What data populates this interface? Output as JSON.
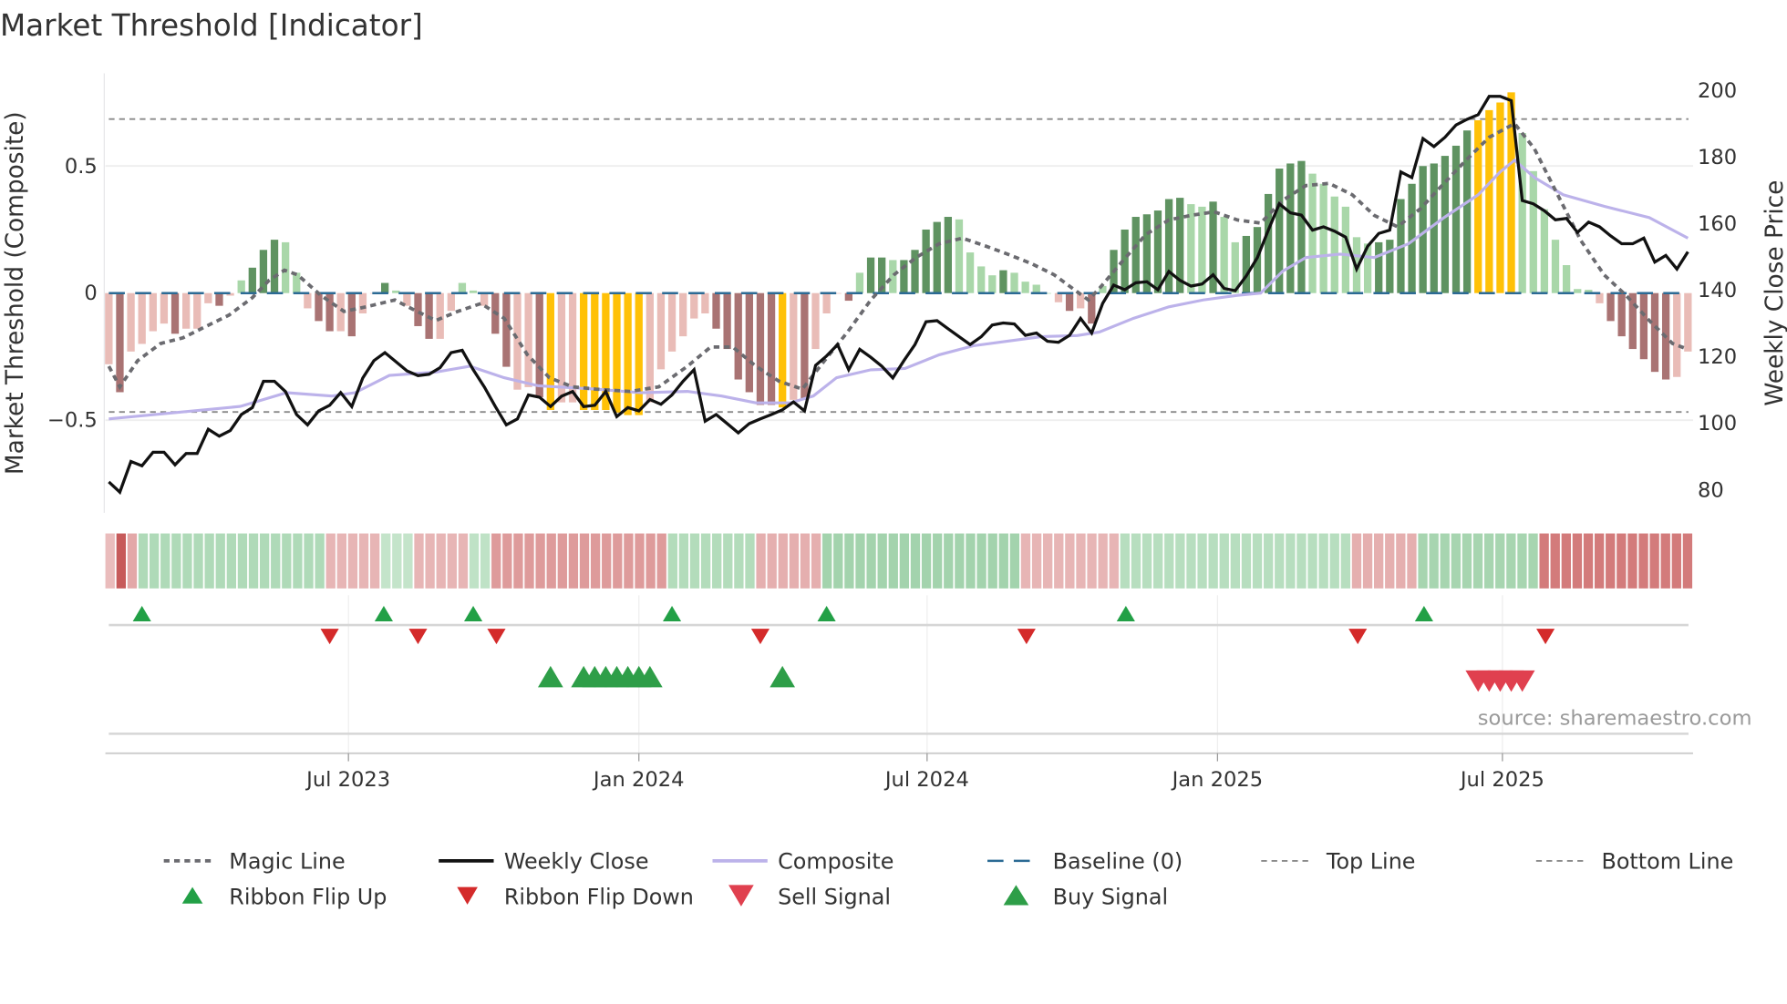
{
  "chart_data": {
    "type": "bar",
    "title": "Market Threshold [Indicator]",
    "x_unit": "weeks since start of series",
    "x_ticks": [
      {
        "week": 21.7,
        "label": "Jul 2023"
      },
      {
        "week": 48.0,
        "label": "Jan 2024"
      },
      {
        "week": 74.1,
        "label": "Jul 2024"
      },
      {
        "week": 100.4,
        "label": "Jan 2025"
      },
      {
        "week": 126.2,
        "label": "Jul 2025"
      }
    ],
    "left_axis": {
      "label": "Market Threshold (Composite)",
      "ticks": [
        {
          "value": 0.5,
          "label": "0.5"
        },
        {
          "value": 0,
          "label": "0"
        },
        {
          "value": -0.5,
          "label": "−0.5"
        }
      ]
    },
    "right_axis": {
      "label": "Weekly Close Price",
      "ticks": [
        {
          "value": 200,
          "label": "200"
        },
        {
          "value": 180,
          "label": "180"
        },
        {
          "value": 160,
          "label": "160"
        },
        {
          "value": 140,
          "label": "140"
        },
        {
          "value": 120,
          "label": "120"
        },
        {
          "value": 100,
          "label": "100"
        },
        {
          "value": 80,
          "label": "80"
        }
      ]
    },
    "top_line": 0.685,
    "bottom_line": -0.468,
    "baseline": 0,
    "palette": {
      "dr": "#a97373",
      "lr": "#e9bcb7",
      "dg": "#5f9361",
      "lg": "#a9d7a9",
      "y": "#ffc107",
      "magic": "#6b6b70",
      "close": "#111111",
      "composite": "#bcb2ea",
      "baseline": "#2b6a94",
      "threshold": "#8a8a8a",
      "flip_up": "#22a046",
      "flip_down": "#d42a2a",
      "buy": "#2e9e48",
      "sell": "#e0404f"
    },
    "bars": {
      "values": [
        -0.28,
        -0.39,
        -0.23,
        -0.2,
        -0.15,
        -0.12,
        -0.16,
        -0.14,
        -0.14,
        -0.04,
        -0.05,
        -0.01,
        0.05,
        0.1,
        0.17,
        0.21,
        0.2,
        0.08,
        -0.06,
        -0.11,
        -0.15,
        -0.15,
        -0.17,
        -0.08,
        0,
        0.04,
        0.01,
        -0.05,
        -0.13,
        -0.18,
        -0.18,
        -0.07,
        0.04,
        0.01,
        -0.05,
        -0.16,
        -0.29,
        -0.38,
        -0.37,
        -0.41,
        -0.46,
        -0.43,
        -0.43,
        -0.46,
        -0.46,
        -0.46,
        -0.47,
        -0.48,
        -0.48,
        -0.43,
        -0.3,
        -0.23,
        -0.17,
        -0.1,
        -0.08,
        -0.14,
        -0.22,
        -0.34,
        -0.39,
        -0.44,
        -0.44,
        -0.45,
        -0.42,
        -0.42,
        -0.22,
        -0.08,
        0,
        -0.03,
        0.08,
        0.14,
        0.14,
        0.13,
        0.13,
        0.17,
        0.25,
        0.28,
        0.3,
        0.29,
        0.16,
        0.105,
        0.07,
        0.09,
        0.08,
        0.045,
        0.033,
        0,
        -0.036,
        -0.07,
        -0.06,
        -0.12,
        0.028,
        0.17,
        0.25,
        0.3,
        0.31,
        0.325,
        0.37,
        0.375,
        0.35,
        0.34,
        0.36,
        0.3,
        0.2,
        0.225,
        0.26,
        0.39,
        0.49,
        0.51,
        0.52,
        0.47,
        0.43,
        0.38,
        0.34,
        0.22,
        0.195,
        0.2,
        0.21,
        0.37,
        0.43,
        0.5,
        0.51,
        0.54,
        0.58,
        0.64,
        0.68,
        0.72,
        0.75,
        0.79,
        0.63,
        0.48,
        0.33,
        0.21,
        0.11,
        0.016,
        0.013,
        -0.04,
        -0.11,
        -0.17,
        -0.22,
        -0.26,
        -0.31,
        -0.34,
        -0.33,
        -0.23
      ],
      "colors": [
        "lr",
        "dr",
        "lr",
        "lr",
        "lr",
        "lr",
        "dr",
        "lr",
        "lr",
        "lr",
        "dr",
        "lr",
        "lg",
        "dg",
        "dg",
        "dg",
        "lg",
        "lg",
        "lr",
        "dr",
        "dr",
        "lr",
        "dr",
        "lr",
        "lr",
        "dg",
        "lg",
        "lr",
        "dr",
        "dr",
        "lr",
        "lr",
        "lg",
        "lg",
        "lr",
        "dr",
        "dr",
        "lr",
        "lr",
        "dr",
        "y",
        "lr",
        "lr",
        "y",
        "y",
        "y",
        "y",
        "y",
        "y",
        "lr",
        "lr",
        "lr",
        "lr",
        "lr",
        "lr",
        "dr",
        "dr",
        "dr",
        "dr",
        "dr",
        "dr",
        "y",
        "lr",
        "dr",
        "lr",
        "lr",
        "lr",
        "dr",
        "lg",
        "dg",
        "dg",
        "lg",
        "dg",
        "dg",
        "dg",
        "dg",
        "dg",
        "lg",
        "lg",
        "lg",
        "lg",
        "dg",
        "lg",
        "lg",
        "lg",
        "lg",
        "lr",
        "dr",
        "lr",
        "dr",
        "lg",
        "dg",
        "dg",
        "dg",
        "dg",
        "dg",
        "dg",
        "dg",
        "lg",
        "lg",
        "dg",
        "lg",
        "lg",
        "dg",
        "dg",
        "dg",
        "dg",
        "dg",
        "dg",
        "lg",
        "lg",
        "lg",
        "lg",
        "lg",
        "lg",
        "dg",
        "dg",
        "dg",
        "dg",
        "dg",
        "dg",
        "dg",
        "dg",
        "dg",
        "y",
        "y",
        "y",
        "y",
        "lg",
        "lg",
        "lg",
        "lg",
        "lg",
        "lg",
        "lg",
        "lr",
        "dr",
        "dr",
        "dr",
        "dr",
        "dr",
        "dr",
        "lr",
        "lr"
      ]
    },
    "magic_line": [
      [
        0,
        -0.288
      ],
      [
        1,
        -0.369
      ],
      [
        2.6,
        -0.266
      ],
      [
        4.7,
        -0.198
      ],
      [
        6.7,
        -0.176
      ],
      [
        8.8,
        -0.131
      ],
      [
        10.9,
        -0.086
      ],
      [
        13,
        -0.018
      ],
      [
        14.5,
        0.05
      ],
      [
        15.9,
        0.09
      ],
      [
        17.1,
        0.072
      ],
      [
        19.2,
        -0.009
      ],
      [
        21.3,
        -0.072
      ],
      [
        23.3,
        -0.054
      ],
      [
        25.9,
        -0.027
      ],
      [
        27.5,
        -0.063
      ],
      [
        29.6,
        -0.108
      ],
      [
        31.6,
        -0.072
      ],
      [
        33.7,
        -0.041
      ],
      [
        35.8,
        -0.099
      ],
      [
        37.9,
        -0.243
      ],
      [
        39.9,
        -0.333
      ],
      [
        42,
        -0.369
      ],
      [
        44.1,
        -0.378
      ],
      [
        47.2,
        -0.387
      ],
      [
        49.8,
        -0.369
      ],
      [
        52.4,
        -0.288
      ],
      [
        54.5,
        -0.212
      ],
      [
        56.5,
        -0.212
      ],
      [
        58.6,
        -0.288
      ],
      [
        60.7,
        -0.347
      ],
      [
        62.8,
        -0.378
      ],
      [
        64.8,
        -0.266
      ],
      [
        66.9,
        -0.153
      ],
      [
        69,
        -0.027
      ],
      [
        71.1,
        0.072
      ],
      [
        73.1,
        0.14
      ],
      [
        75.2,
        0.194
      ],
      [
        77.3,
        0.216
      ],
      [
        79.4,
        0.185
      ],
      [
        81.4,
        0.153
      ],
      [
        83.5,
        0.117
      ],
      [
        85.6,
        0.072
      ],
      [
        87.7,
        0.005
      ],
      [
        88.7,
        -0.027
      ],
      [
        89.7,
        0.018
      ],
      [
        91.8,
        0.126
      ],
      [
        93.9,
        0.23
      ],
      [
        96,
        0.288
      ],
      [
        98,
        0.306
      ],
      [
        100.1,
        0.32
      ],
      [
        102.2,
        0.288
      ],
      [
        104.3,
        0.275
      ],
      [
        106.3,
        0.365
      ],
      [
        108.4,
        0.423
      ],
      [
        110.5,
        0.432
      ],
      [
        112.6,
        0.387
      ],
      [
        114.6,
        0.306
      ],
      [
        116.7,
        0.261
      ],
      [
        118.8,
        0.333
      ],
      [
        120.9,
        0.432
      ],
      [
        122.9,
        0.523
      ],
      [
        125,
        0.613
      ],
      [
        127.3,
        0.667
      ],
      [
        129.1,
        0.568
      ],
      [
        131.2,
        0.387
      ],
      [
        133.3,
        0.207
      ],
      [
        135.4,
        0.072
      ],
      [
        137.4,
        -0.009
      ],
      [
        139.5,
        -0.108
      ],
      [
        141.6,
        -0.198
      ],
      [
        143,
        -0.221
      ]
    ],
    "composite": [
      [
        0,
        -0.495
      ],
      [
        11.9,
        -0.446
      ],
      [
        16.1,
        -0.392
      ],
      [
        20.2,
        -0.405
      ],
      [
        22.3,
        -0.392
      ],
      [
        25.4,
        -0.324
      ],
      [
        29.6,
        -0.311
      ],
      [
        32.7,
        -0.288
      ],
      [
        35.8,
        -0.333
      ],
      [
        38.9,
        -0.365
      ],
      [
        44.1,
        -0.378
      ],
      [
        48.2,
        -0.392
      ],
      [
        52.4,
        -0.387
      ],
      [
        55.5,
        -0.405
      ],
      [
        58.6,
        -0.432
      ],
      [
        61.7,
        -0.432
      ],
      [
        63.8,
        -0.405
      ],
      [
        65.9,
        -0.333
      ],
      [
        69,
        -0.302
      ],
      [
        72.1,
        -0.297
      ],
      [
        75.2,
        -0.243
      ],
      [
        78.3,
        -0.207
      ],
      [
        81.4,
        -0.189
      ],
      [
        84.5,
        -0.171
      ],
      [
        87.7,
        -0.167
      ],
      [
        89.7,
        -0.153
      ],
      [
        92.8,
        -0.099
      ],
      [
        96,
        -0.054
      ],
      [
        99.1,
        -0.027
      ],
      [
        102.2,
        -0.009
      ],
      [
        104.3,
        0
      ],
      [
        106.3,
        0.086
      ],
      [
        108.4,
        0.14
      ],
      [
        111.5,
        0.153
      ],
      [
        114.6,
        0.14
      ],
      [
        117.7,
        0.194
      ],
      [
        120.9,
        0.297
      ],
      [
        124,
        0.387
      ],
      [
        126,
        0.477
      ],
      [
        127.3,
        0.523
      ],
      [
        129.1,
        0.455
      ],
      [
        131.7,
        0.387
      ],
      [
        135.4,
        0.342
      ],
      [
        139.5,
        0.297
      ],
      [
        143,
        0.216
      ]
    ],
    "weekly_close": [
      82.1,
      79.0,
      88.2,
      86.9,
      91.0,
      91.0,
      87.2,
      90.6,
      90.6,
      97.9,
      95.8,
      97.5,
      102.3,
      104.4,
      112.3,
      112.3,
      109.2,
      102.3,
      99.2,
      103.4,
      105.1,
      108.9,
      104.7,
      113.3,
      118.5,
      120.9,
      118.2,
      115.4,
      114.0,
      114.4,
      116.4,
      120.9,
      121.6,
      115.8,
      110.6,
      104.7,
      99.2,
      101.0,
      108.2,
      107.5,
      104.7,
      107.8,
      109.2,
      104.7,
      105.1,
      109.2,
      101.7,
      104.4,
      103.4,
      106.8,
      105.4,
      108.2,
      112.3,
      115.8,
      100.3,
      102.3,
      99.6,
      96.8,
      99.6,
      101.0,
      102.3,
      103.7,
      106.1,
      103.4,
      117.1,
      119.9,
      123.3,
      115.8,
      121.9,
      119.5,
      116.8,
      113.3,
      118.5,
      123.3,
      130.2,
      130.5,
      128.1,
      125.7,
      123.3,
      125.7,
      129.2,
      129.8,
      129.5,
      126.1,
      126.8,
      124.3,
      124.0,
      126.1,
      131.2,
      126.8,
      135.7,
      141.2,
      139.8,
      141.9,
      142.2,
      139.8,
      145.3,
      142.6,
      140.9,
      141.5,
      144.3,
      140.2,
      139.5,
      143.9,
      149.4,
      157.7,
      165.6,
      162.9,
      162.2,
      157.7,
      158.7,
      157.4,
      155.6,
      146.0,
      152.9,
      156.7,
      157.7,
      175.2,
      173.5,
      185.2,
      182.8,
      185.6,
      189.3,
      191.0,
      192.4,
      197.9,
      197.9,
      196.6,
      166.6,
      165.6,
      163.5,
      160.8,
      161.2,
      157.0,
      160.1,
      158.7,
      156.0,
      153.6,
      153.6,
      155.3,
      148.1,
      150.1,
      146.0,
      151.2
    ],
    "ribbon": [
      {
        "start": 0,
        "end": 0,
        "state": "bear",
        "strength": 0.25
      },
      {
        "start": 1,
        "end": 1,
        "state": "bear",
        "strength": 1.0
      },
      {
        "start": 2,
        "end": 2,
        "state": "bear",
        "strength": 0.4
      },
      {
        "start": 3,
        "end": 19,
        "state": "bull",
        "strength": 0.5
      },
      {
        "start": 20,
        "end": 24,
        "state": "bear",
        "strength": 0.3
      },
      {
        "start": 25,
        "end": 27,
        "state": "bull",
        "strength": 0.25
      },
      {
        "start": 28,
        "end": 32,
        "state": "bear",
        "strength": 0.3
      },
      {
        "start": 33,
        "end": 34,
        "state": "bull",
        "strength": 0.3
      },
      {
        "start": 35,
        "end": 50,
        "state": "bear",
        "strength": 0.5
      },
      {
        "start": 51,
        "end": 58,
        "state": "bull",
        "strength": 0.45
      },
      {
        "start": 59,
        "end": 64,
        "state": "bear",
        "strength": 0.35
      },
      {
        "start": 65,
        "end": 82,
        "state": "bull",
        "strength": 0.65
      },
      {
        "start": 83,
        "end": 91,
        "state": "bear",
        "strength": 0.3
      },
      {
        "start": 92,
        "end": 112,
        "state": "bull",
        "strength": 0.4
      },
      {
        "start": 113,
        "end": 118,
        "state": "bear",
        "strength": 0.35
      },
      {
        "start": 119,
        "end": 129,
        "state": "bull",
        "strength": 0.6
      },
      {
        "start": 130,
        "end": 143,
        "state": "bear",
        "strength": 0.75
      }
    ],
    "signals": {
      "ribbon_flip_up": [
        3,
        24.9,
        33,
        51,
        65,
        92.1,
        119.1
      ],
      "ribbon_flip_down": [
        20,
        28,
        35.1,
        59,
        83.1,
        113.1,
        130.1
      ],
      "buy": [
        40,
        43,
        44,
        45,
        46,
        47,
        48,
        49,
        61
      ],
      "sell": [
        124,
        125,
        126,
        127,
        128
      ]
    },
    "legend": [
      {
        "label": "Magic Line",
        "style": "magic"
      },
      {
        "label": "Weekly Close",
        "style": "close"
      },
      {
        "label": "Composite",
        "style": "composite"
      },
      {
        "label": "Baseline (0)",
        "style": "baseline"
      },
      {
        "label": "Top Line",
        "style": "threshold"
      },
      {
        "label": "Bottom Line",
        "style": "threshold"
      },
      {
        "label": "Ribbon Flip Up",
        "style": "flip_up"
      },
      {
        "label": "Ribbon Flip Down",
        "style": "flip_down"
      },
      {
        "label": "Sell Signal",
        "style": "sell"
      },
      {
        "label": "Buy Signal",
        "style": "buy"
      }
    ],
    "source": "source: sharemaestro.com"
  }
}
